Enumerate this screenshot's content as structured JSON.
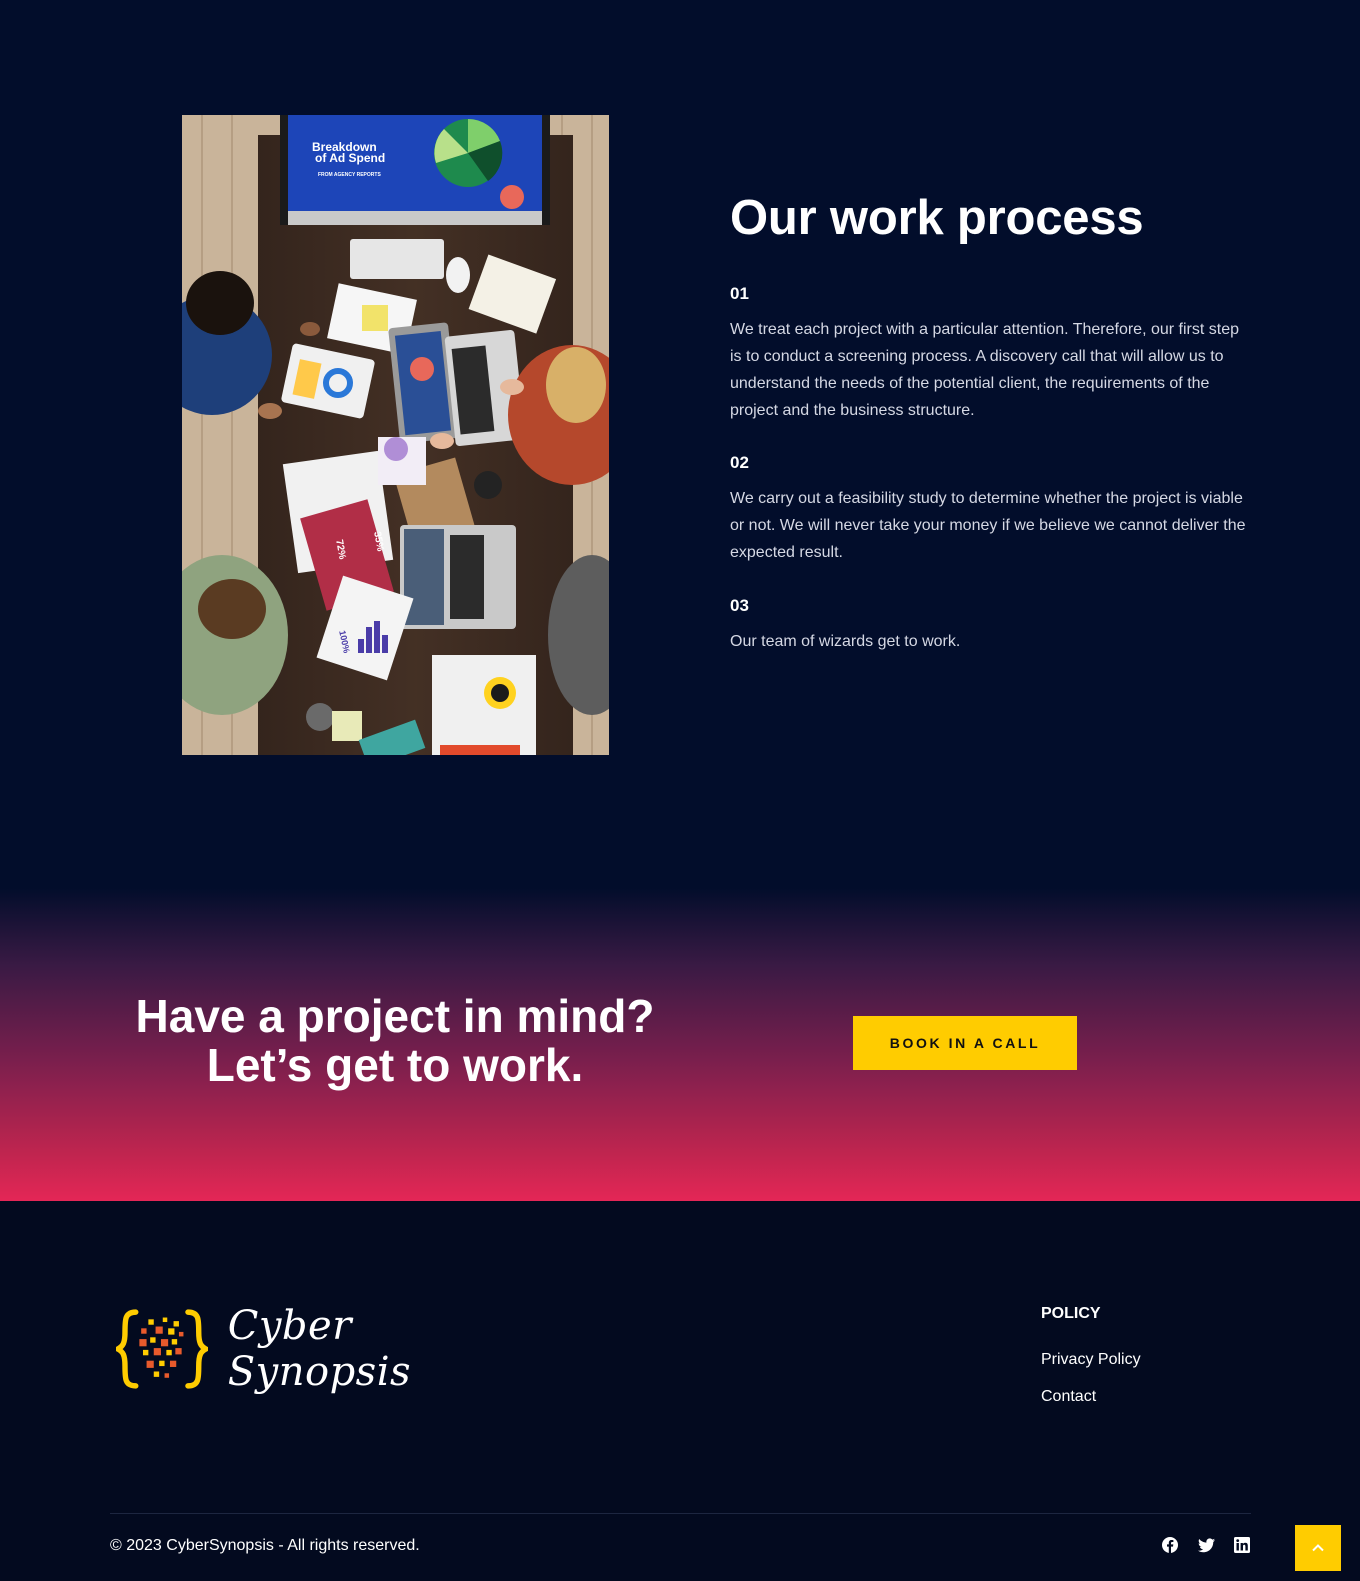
{
  "process": {
    "title": "Our work process",
    "photo_alt": "Team working around a table",
    "steps": [
      {
        "number": "01",
        "text": "We treat each project with a particular attention. Therefore, our first step is to conduct a screening process. A discovery call that will allow us to understand the needs of the potential client, the requirements of the project and the business structure."
      },
      {
        "number": "02",
        "text": "We carry out a feasibility study to determine whether the project is viable or not. We will never take your money if we believe we cannot deliver the expected result."
      },
      {
        "number": "03",
        "text": "Our team of wizards get to work."
      }
    ],
    "photo_screen": {
      "title_line1": "Breakdown",
      "title_line2": "of Ad Spend",
      "subtitle": "FROM AGENCY REPORTS"
    },
    "photo_labels": {
      "label_72": "72%",
      "label_35": "35%",
      "label_100": "100%"
    }
  },
  "cta": {
    "heading_line1": "Have a project in mind?",
    "heading_line2": "Let’s get to work.",
    "button_label": "BOOK IN A CALL"
  },
  "footer": {
    "brand": "Cyber Synopsis",
    "policy_heading": "POLICY",
    "links": [
      "Privacy Policy",
      "Contact"
    ],
    "copyright": "© 2023 CyberSynopsis - All rights reserved.",
    "socials": [
      "facebook-icon",
      "twitter-icon",
      "linkedin-icon"
    ],
    "back_to_top_icon": "chevron-up-icon"
  },
  "colors": {
    "background": "#020d2b",
    "footer_bg": "#030a1f",
    "accent": "#ffcc00",
    "cta_gradient_end": "#e42656"
  }
}
